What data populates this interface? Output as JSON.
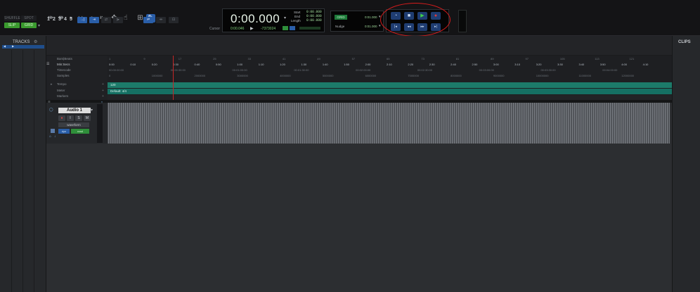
{
  "toolbar": {
    "edit_modes": [
      "SHUFFLE",
      "SPOT",
      "SLIP",
      "GRID"
    ],
    "zoom_presets": [
      "1",
      "2",
      "3",
      "4",
      "5"
    ],
    "counter": {
      "main": "0:00.000",
      "start_label": "Start",
      "end_label": "End",
      "length_label": "Length",
      "start": "0:00.000",
      "end": "0:00.000",
      "length": "0:00.000",
      "cursor_label": "Cursor",
      "cursor_value": "0:00.046",
      "sample_value": "-7373024"
    },
    "grid": {
      "tag": "GRID",
      "grid_value": "0:01.000",
      "nudge_label": "Nudge",
      "nudge_value": "0:01.000"
    }
  },
  "tracks_panel": {
    "title": "TRACKS"
  },
  "clips_panel": {
    "title": "CLIPS"
  },
  "rulers": {
    "labels": [
      "Bars|Beats",
      "Min:Secs",
      "Timecode",
      "Samples",
      "Tempo",
      "Meter",
      "Markers"
    ],
    "bars": [
      "1",
      "9",
      "17",
      "25",
      "33",
      "41",
      "49",
      "57",
      "65",
      "73",
      "81",
      "89",
      "97",
      "105",
      "113",
      "121"
    ],
    "minsecs": [
      "0:00",
      "0:10",
      "0:20",
      "0:30",
      "0:40",
      "0:50",
      "1:00",
      "1:10",
      "1:20",
      "1:30",
      "1:40",
      "1:50",
      "2:00",
      "2:10",
      "2:20",
      "2:30",
      "2:40",
      "2:50",
      "3:00",
      "3:10",
      "3:20",
      "3:30",
      "3:40",
      "3:50",
      "4:00",
      "4:10"
    ],
    "timecode": [
      "00:00:00:00",
      "00:00:30:00",
      "00:01:00:00",
      "00:01:30:00",
      "00:02:00:00",
      "00:02:30:00",
      "00:03:00:00",
      "00:03:30:00",
      "00:04:00:00"
    ],
    "samples": [
      "0",
      "1000000",
      "2000000",
      "3000000",
      "4000000",
      "5000000",
      "6000000",
      "7000000",
      "8000000",
      "9000000",
      "10000000",
      "11000000",
      "12000000"
    ],
    "tempo_value": "120",
    "meter_value": "Default: 4/4"
  },
  "track": {
    "name": "Audio 1",
    "rec": "●",
    "input": "I",
    "solo": "S",
    "mute": "M",
    "view": "waveform",
    "io": "dyn",
    "vol": "read"
  },
  "colors": {
    "accent_blue": "#2a5ea8",
    "ruler_teal": "#1c7b6a",
    "highlight_red": "#d61c1c",
    "grid_green": "#3a9a2e"
  }
}
